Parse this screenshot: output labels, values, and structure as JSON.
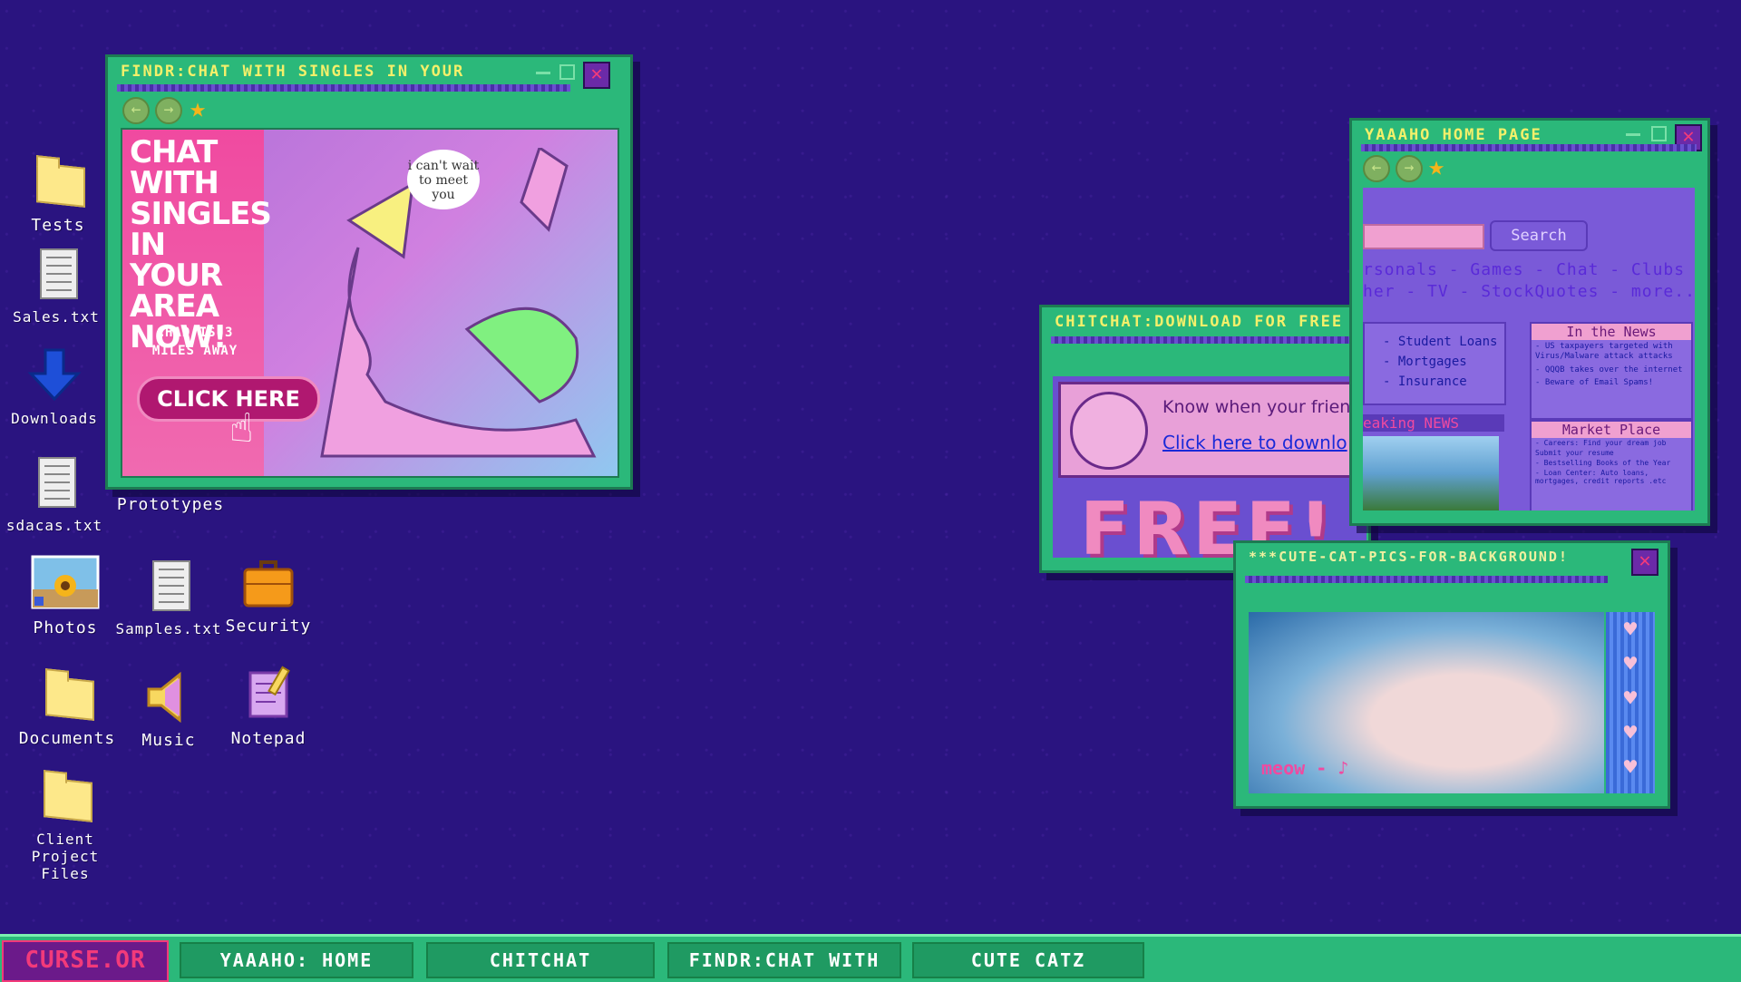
{
  "desktop": {
    "icons": {
      "tests": "Tests",
      "sales": "Sales.txt",
      "downloads": "Downloads",
      "sdacas": "sdacas.txt",
      "prototypes": "Prototypes",
      "photos": "Photos",
      "samples": "Samples.txt",
      "security": "Security",
      "documents": "Documents",
      "music": "Music",
      "notepad": "Notepad",
      "client_project_files": "Client Project Files"
    }
  },
  "findr_window": {
    "title": "FINDR:CHAT WITH SINGLES IN YOUR",
    "ad_headline": "CHAT WITH SINGLES IN YOUR AREA NOW!",
    "ad_sub": "CHAD IS 3 MILES AWAY",
    "cta": "CLICK HERE",
    "speech": "i can't wait to meet you"
  },
  "chitchat_window": {
    "title": "CHITCHAT:DOWNLOAD FOR FREE",
    "banner_text": "Know when your friends a",
    "banner_link": "Click here to downlo",
    "free_text": "FREE!"
  },
  "yaaaho_window": {
    "title": "YAAAHO HOME PAGE",
    "search_button": "Search",
    "nav_line1": "rsonals - Games - Chat - Clubs",
    "nav_line2": "her - TV - StockQuotes - more...",
    "links": [
      "- Student Loans",
      "- Mortgages",
      "- Insurance"
    ],
    "breaking": "eaking NEWS",
    "news_header": "In the News",
    "news_items": [
      "- US taxpayers targeted with Virus/Malware attack attacks",
      "- QQQB takes over the internet",
      "- Beware of Email Spams!"
    ],
    "market_header": "Market Place",
    "market_items": [
      "- Careers: Find your dream job",
      "  Submit your resume",
      "- Bestselling Books of the Year",
      "- Loan Center: Auto loans, mortgages, credit reports .etc"
    ]
  },
  "cat_window": {
    "title": "***CUTE-CAT-PICS-FOR-BACKGROUND!",
    "caption": "meow - ♪"
  },
  "taskbar": {
    "start": "CURSE.OR",
    "tasks": [
      "YAAAHO: HOME",
      "CHITCHAT",
      "FINDR:CHAT WITH",
      "CUTE CATZ"
    ]
  }
}
